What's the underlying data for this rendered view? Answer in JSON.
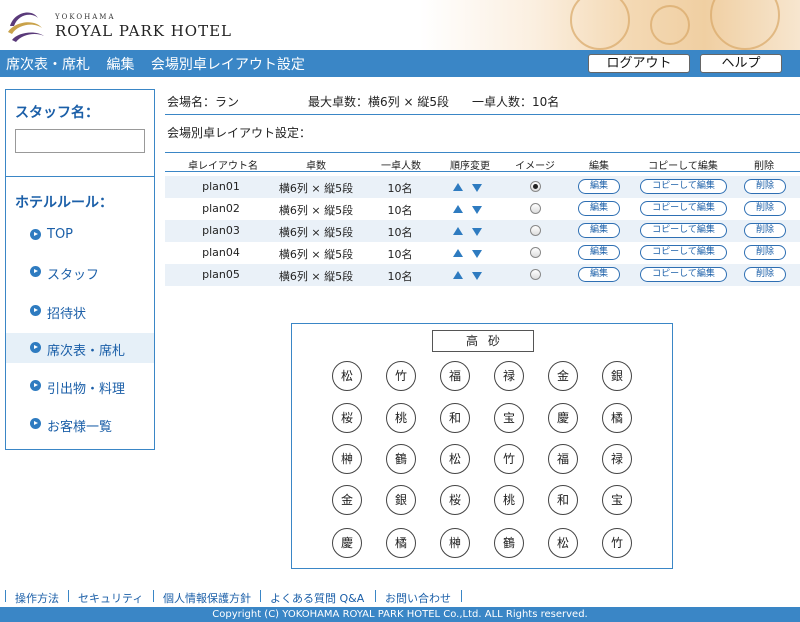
{
  "header": {
    "logo_small": "YOKOHAMA",
    "logo_big": "ROYAL PARK HOTEL"
  },
  "nav": {
    "crumbs": [
      "席次表・席札",
      "編集",
      "会場別卓レイアウト設定"
    ],
    "logout_label": "ログアウト",
    "help_label": "ヘルプ"
  },
  "sidebar": {
    "staff_label": "スタッフ名：",
    "staff_value": "",
    "rules_label": "ホテルルール：",
    "items": [
      {
        "label": "TOP",
        "active": false
      },
      {
        "label": "スタッフ",
        "active": false
      },
      {
        "label": "招待状",
        "active": false
      },
      {
        "label": "席次表・席札",
        "active": true
      },
      {
        "label": "引出物・料理",
        "active": false
      },
      {
        "label": "お客様一覧",
        "active": false
      }
    ]
  },
  "main": {
    "venue": "会場名：ラン",
    "max_tables": "最大卓数：横6列 × 縦5段",
    "per_table": "一卓人数：10名",
    "section_title": "会場別卓レイアウト設定："
  },
  "table_headers": [
    "卓レイアウト名",
    "卓数",
    "一卓人数",
    "順序変更",
    "イメージ",
    "編集",
    "コピーして編集",
    "削除"
  ],
  "plans": [
    {
      "name": "plan01",
      "tables": "横6列 × 縦5段",
      "people": "10名",
      "selected": true
    },
    {
      "name": "plan02",
      "tables": "横6列 × 縦5段",
      "people": "10名",
      "selected": false
    },
    {
      "name": "plan03",
      "tables": "横6列 × 縦5段",
      "people": "10名",
      "selected": false
    },
    {
      "name": "plan04",
      "tables": "横6列 × 縦5段",
      "people": "10名",
      "selected": false
    },
    {
      "name": "plan05",
      "tables": "横6列 × 縦5段",
      "people": "10名",
      "selected": false
    }
  ],
  "row_buttons": {
    "edit": "編集",
    "copy_edit": "コピーして編集",
    "delete": "削除"
  },
  "layout_preview": {
    "head_table": "高砂",
    "tables": [
      [
        "松",
        "竹",
        "福",
        "禄",
        "金",
        "銀"
      ],
      [
        "桜",
        "桃",
        "和",
        "宝",
        "慶",
        "橘"
      ],
      [
        "榊",
        "鶴",
        "松",
        "竹",
        "福",
        "禄"
      ],
      [
        "金",
        "銀",
        "桜",
        "桃",
        "和",
        "宝"
      ],
      [
        "慶",
        "橘",
        "榊",
        "鶴",
        "松",
        "竹"
      ]
    ]
  },
  "footer": {
    "links": [
      "操作方法",
      "セキュリティ",
      "個人情報保護方針",
      "よくある質問 Q&A",
      "お問い合わせ"
    ],
    "copyright": "Copyright (C) YOKOHAMA ROYAL PARK HOTEL Co.,Ltd. ALL Rights reserved."
  },
  "colors": {
    "accent": "#3a86c6",
    "link": "#1b5fa8"
  }
}
